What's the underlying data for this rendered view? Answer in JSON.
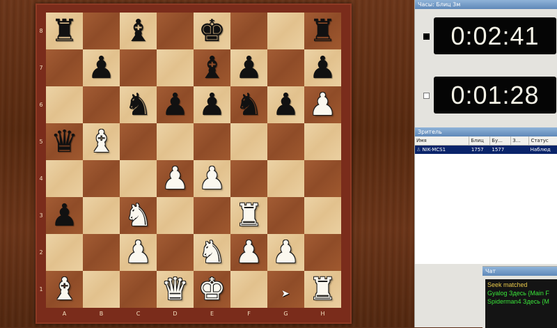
{
  "board": {
    "rank_labels": [
      "8",
      "7",
      "6",
      "5",
      "4",
      "3",
      "2",
      "1"
    ],
    "file_labels": [
      "A",
      "B",
      "C",
      "D",
      "E",
      "F",
      "G",
      "H"
    ],
    "position": [
      [
        "br",
        "",
        "bb",
        "",
        "bk",
        "",
        "",
        "br"
      ],
      [
        "",
        "bp",
        "",
        "",
        "bb",
        "bp",
        "",
        "bp"
      ],
      [
        "",
        "",
        "bn",
        "bp",
        "bp",
        "bn",
        "bp",
        "wp"
      ],
      [
        "bq",
        "wb",
        "",
        "",
        "",
        "",
        "",
        ""
      ],
      [
        "",
        "",
        "",
        "wp",
        "wp",
        "",
        "",
        ""
      ],
      [
        "bp",
        "",
        "wn",
        "",
        "",
        "wr",
        "",
        ""
      ],
      [
        "",
        "",
        "wp",
        "",
        "wn",
        "wp",
        "wp",
        ""
      ],
      [
        "wb",
        "",
        "",
        "wq",
        "wk",
        "",
        "",
        "wr"
      ]
    ],
    "light_color": "#e8cc9b",
    "dark_color": "#9a5530"
  },
  "clocks": {
    "panel_title": "Часы: Блиц 3м",
    "white_time": "0:02:41",
    "black_time": "0:01:28"
  },
  "spectators": {
    "panel_title": "Зритель",
    "columns": [
      "Имя",
      "Блиц",
      "Бу...",
      "З...",
      "Статус"
    ],
    "rows": [
      {
        "name": "NIK-MCS1",
        "blitz": "1757",
        "bullet": "1577",
        "z": "",
        "status": "Наблюд"
      }
    ]
  },
  "chat": {
    "panel_title": "Чат",
    "lines": [
      {
        "text": "Seek matched",
        "color": "#e8c84a"
      },
      {
        "text": "Gyalog Здесь {Main F",
        "color": "#39e339"
      },
      {
        "text": "Spiderman4 Здесь {M",
        "color": "#39e339"
      }
    ]
  }
}
